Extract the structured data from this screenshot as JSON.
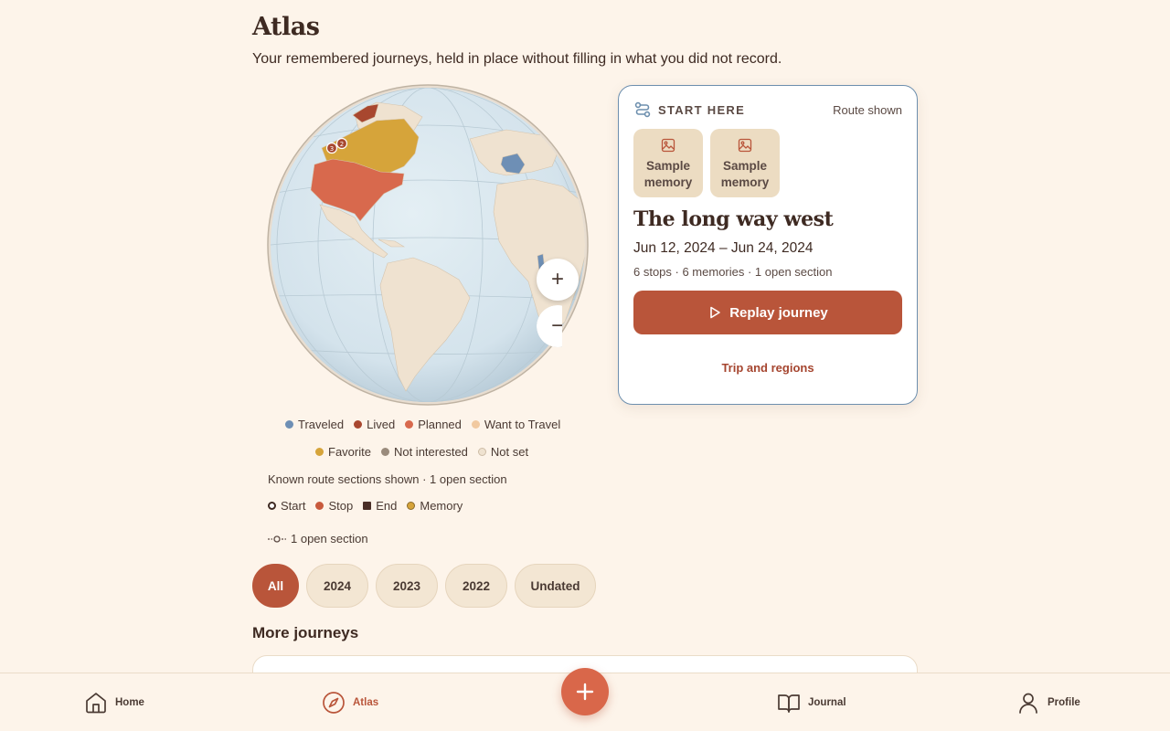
{
  "header": {
    "title": "Atlas",
    "subtitle": "Your remembered journeys, held in place without filling in what you did not record."
  },
  "globe": {
    "zoom_in": "+",
    "zoom_out": "−",
    "route_markers": [
      "3",
      "2"
    ]
  },
  "feature_card": {
    "eyebrow": "START HERE",
    "route_status": "Route shown",
    "thumbnails": [
      "Sample memory",
      "Sample memory"
    ],
    "title": "The long way west",
    "dates": "Jun 12, 2024 – Jun 24, 2024",
    "stats": "6 stops · 6 memories · 1 open section",
    "replay_label": "Replay journey",
    "trip_link": "Trip and regions"
  },
  "legend": {
    "statuses_row1": [
      {
        "label": "Traveled",
        "color": "#6e8fb5"
      },
      {
        "label": "Lived",
        "color": "#a8472f"
      },
      {
        "label": "Planned",
        "color": "#d8694d"
      },
      {
        "label": "Want to Travel",
        "color": "#f1c9a0"
      }
    ],
    "statuses_row2": [
      {
        "label": "Favorite",
        "color": "#d6a43a"
      },
      {
        "label": "Not interested",
        "color": "#9a8b7c"
      },
      {
        "label": "Not set",
        "color": "#efe2d0"
      }
    ],
    "route_note": "Known route sections shown · 1 open section",
    "route_marks": [
      {
        "label": "Start",
        "shape": "ring"
      },
      {
        "label": "Stop",
        "shape": "dot",
        "color": "#c85a3d"
      },
      {
        "label": "End",
        "shape": "square",
        "color": "#4a2f27"
      },
      {
        "label": "Memory",
        "shape": "dot",
        "color": "#d6a43a"
      }
    ],
    "open_section": "1 open section"
  },
  "filters": {
    "chips": [
      "All",
      "2024",
      "2023",
      "2022",
      "Undated"
    ],
    "active": "All"
  },
  "more_journeys": {
    "title": "More journeys"
  },
  "nav": {
    "items": [
      {
        "label": "Home",
        "icon": "home-icon"
      },
      {
        "label": "Atlas",
        "icon": "compass-icon",
        "active": true
      },
      {
        "label": "Journal",
        "icon": "book-icon"
      },
      {
        "label": "Profile",
        "icon": "user-icon"
      }
    ],
    "fab": "+"
  }
}
